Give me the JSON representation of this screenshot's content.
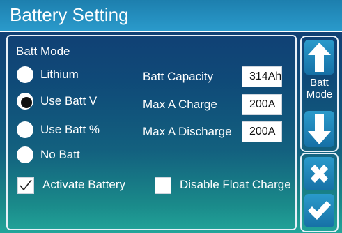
{
  "header": {
    "title": "Battery Setting"
  },
  "batt_mode": {
    "title": "Batt Mode",
    "options": [
      {
        "label": "Lithium",
        "selected": false
      },
      {
        "label": "Use Batt V",
        "selected": true
      },
      {
        "label": "Use Batt %",
        "selected": false
      },
      {
        "label": "No Batt",
        "selected": false
      }
    ]
  },
  "settings": [
    {
      "label": "Batt Capacity",
      "value": "314Ah"
    },
    {
      "label": "Max A Charge",
      "value": "200A"
    },
    {
      "label": "Max A Discharge",
      "value": "200A"
    }
  ],
  "checkboxes": {
    "activate_battery": {
      "label": "Activate Battery",
      "checked": true
    },
    "disable_float_charge": {
      "label": "Disable Float Charge",
      "checked": false
    }
  },
  "side": {
    "mode_label_line1": "Batt",
    "mode_label_line2": "Mode",
    "up_icon": "arrow-up-icon",
    "down_icon": "arrow-down-icon",
    "cancel_icon": "x-icon",
    "confirm_icon": "check-icon"
  },
  "colors": {
    "header": "#2a9acb",
    "button": "#1f86b9",
    "panel_border": "#e8f0f8",
    "text": "#ffffff"
  }
}
